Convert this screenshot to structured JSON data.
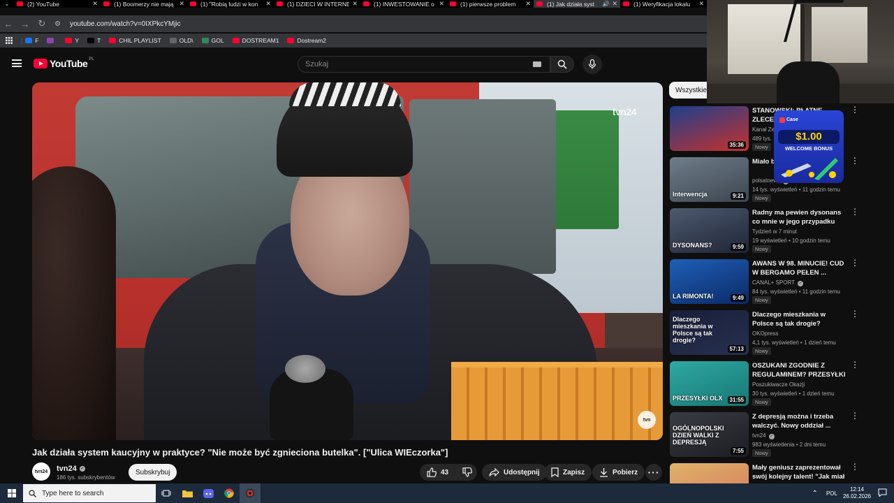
{
  "browser": {
    "tabs": [
      {
        "label": "(2) YouTube",
        "active": false
      },
      {
        "label": "(1) Boomerzy nie mają",
        "active": false
      },
      {
        "label": "(1) \"Robią ludzi w kon",
        "active": false
      },
      {
        "label": "(1) DZIECI W INTERNE",
        "active": false
      },
      {
        "label": "(1) INWESTOWANIE o",
        "active": false
      },
      {
        "label": "(1) pierwsze problem",
        "active": false
      },
      {
        "label": "(1) Jak działa syst",
        "active": true
      },
      {
        "label": "(1) Weryfikacja lokalu",
        "active": false
      }
    ],
    "url": "youtube.com/watch?v=0IXPkcYMjic",
    "bookmarks": [
      {
        "label": "F",
        "color": "#1877f2"
      },
      {
        "label": "",
        "color": "#8e44ad"
      },
      {
        "label": "Y",
        "color": "#ff0033"
      },
      {
        "label": "T",
        "color": "#000000"
      },
      {
        "label": "CHIL PLAYLIST",
        "color": "#ff0033"
      },
      {
        "label": "OLD\\",
        "color": "#666666"
      },
      {
        "label": "GOL",
        "color": "#2e8b57"
      },
      {
        "label": "DOSTREAM1",
        "color": "#ff0033"
      },
      {
        "label": "Dostream2",
        "color": "#ff0033"
      }
    ]
  },
  "youtube": {
    "logo_text": "YouTube",
    "country_code": "PL",
    "search_placeholder": "Szukaj",
    "video": {
      "watermark": "tvn24",
      "corner_logo": "tvn",
      "title": "Jak działa system kaucyjny w praktyce? \"Nie może być zgnieciona butelka\". [\"Ulica WIEczorka\"]",
      "channel": "tvn24",
      "channel_avatar": "tvn24",
      "subscribers": "186 tys. subskrybentów",
      "subscribe_label": "Subskrybuj",
      "likes": "43",
      "share_label": "Udostępnij",
      "save_label": "Zapisz",
      "download_label": "Pobierz"
    },
    "filter_chip": "Wszystkie",
    "recommendations": [
      {
        "title": "STANOWSKI: PŁATNE ZLECENIA…",
        "channel": "Kanał Ze",
        "meta": "489 tys.",
        "badge": "Nowy",
        "duration": "35:36",
        "thumb_label": "",
        "thumb_colors": [
          "#1d3f8f",
          "#c7312b"
        ],
        "verified": false
      },
      {
        "title": "Miało b… kolosalne…",
        "channel": "polsatnews",
        "meta": "14 tys. wyświetleń • 11 godzin temu",
        "badge": "Nowy",
        "duration": "9:21",
        "thumb_label": "Interwencja",
        "thumb_colors": [
          "#6f7d8a",
          "#3c4650"
        ],
        "verified": true
      },
      {
        "title": "Radny ma pewien dysonans co mnie w jego przypadku nie ...",
        "channel": "Tydzień w 7 minut",
        "meta": "19 wyświetleń • 10 godzin temu",
        "badge": "Nowy",
        "duration": "9:59",
        "thumb_label": "DYSONANS?",
        "thumb_colors": [
          "#4e5a70",
          "#1e2535"
        ],
        "verified": false
      },
      {
        "title": "AWANS W 98. MINUCIE! CUD W BERGAMO PEŁEN ...",
        "channel": "CANAL+ SPORT",
        "meta": "84 tys. wyświetleń • 11 godzin temu",
        "badge": "Nowy",
        "duration": "9:49",
        "thumb_label": "LA RIMONTA!",
        "thumb_colors": [
          "#1f5fb8",
          "#0b2a66"
        ],
        "verified": true
      },
      {
        "title": "Dlaczego mieszkania w Polsce są tak drogie? #DlaczegoTak",
        "channel": "OKOpress",
        "meta": "4,1 tys. wyświetleń • 1 dzień temu",
        "badge": "Nowy",
        "duration": "57:13",
        "thumb_label": "Dlaczego mieszkania w Polsce są tak drogie?",
        "thumb_colors": [
          "#1a1f3a",
          "#26304f"
        ],
        "verified": false
      },
      {
        "title": "OSZUKANI ZGODNIE Z REGULAMINEM? PRZESYŁKI ...",
        "channel": "Poszukiwacze Okazji",
        "meta": "30 tys. wyświetleń • 1 dzień temu",
        "badge": "Nowy",
        "duration": "31:55",
        "thumb_label": "PRZESYŁKI OLX",
        "thumb_colors": [
          "#2fa8a3",
          "#177874"
        ],
        "verified": false
      },
      {
        "title": "Z depresją można i trzeba walczyć. Nowy oddział ...",
        "channel": "tvn24",
        "meta": "983 wyświetlenia • 2 dni temu",
        "badge": "Nowy",
        "duration": "7:55",
        "thumb_label": "OGÓLNOPOLSKI DZIEŃ WALKI Z DEPRESJĄ",
        "thumb_colors": [
          "#3a3c44",
          "#1c1d22"
        ],
        "verified": true
      },
      {
        "title": "Mały geniusz zaprezentował swój kolejny talent! \"Jak miał ...",
        "channel": "",
        "meta": "",
        "badge": "",
        "duration": "",
        "thumb_label": "",
        "thumb_colors": [
          "#e0b36a",
          "#d4785c"
        ],
        "verified": false
      }
    ]
  },
  "ad": {
    "brand": "Case",
    "amount": "$1.00",
    "text": "WELCOME BONUS"
  },
  "taskbar": {
    "search_placeholder": "Type here to search",
    "language": "POL",
    "time": "12:14",
    "date": "26.02.2026"
  }
}
